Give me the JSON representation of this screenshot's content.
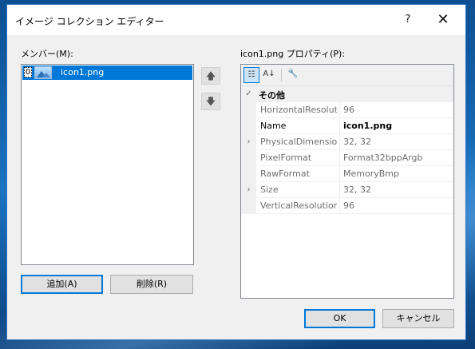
{
  "dialog": {
    "title": "イメージ コレクション エディター",
    "help_glyph": "?",
    "close_glyph": "✕"
  },
  "members": {
    "label": "メンバー(M):",
    "items": [
      {
        "index": "0",
        "name": "icon1.png"
      }
    ],
    "move_up_glyph": "🡅",
    "move_down_glyph": "🡇"
  },
  "buttons": {
    "add": "追加(A)",
    "remove": "削除(R)",
    "ok": "OK",
    "cancel": "キャンセル"
  },
  "properties": {
    "label": "icon1.png プロパティ(P):",
    "toolbar": {
      "categorized_icon": "categorized-icon",
      "alphabetical_icon": "alphabetical-icon",
      "property_pages_icon": "wrench-icon",
      "categorized_glyph": "☷",
      "alphabetical_glyph": "A↓",
      "wrench_glyph": "🔧"
    },
    "category": {
      "name": "その他",
      "expand_glyph": "✓"
    },
    "rows": [
      {
        "name": "HorizontalResolutio",
        "value": "96",
        "expandable": ""
      },
      {
        "name": "Name",
        "value": "icon1.png",
        "expandable": ""
      },
      {
        "name": "PhysicalDimension",
        "value": "32, 32",
        "expandable": "›"
      },
      {
        "name": "PixelFormat",
        "value": "Format32bppArgb",
        "expandable": ""
      },
      {
        "name": "RawFormat",
        "value": "MemoryBmp",
        "expandable": ""
      },
      {
        "name": "Size",
        "value": "32, 32",
        "expandable": "›"
      },
      {
        "name": "VerticalResolution",
        "value": "96",
        "expandable": ""
      }
    ]
  },
  "colors": {
    "selection": "#0078d7",
    "window_border": "#2c73c8",
    "dialog_bg": "#f0f0f0"
  }
}
